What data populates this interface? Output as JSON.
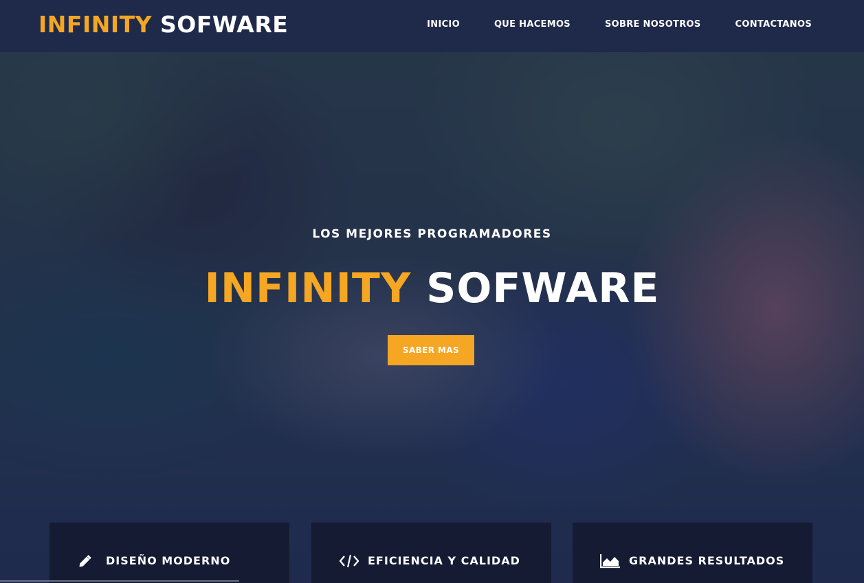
{
  "header": {
    "logo_accent": "INFINITY",
    "logo_rest": "SOFWARE",
    "nav": [
      {
        "label": "INICIO"
      },
      {
        "label": "QUE HACEMOS"
      },
      {
        "label": "SOBRE NOSOTROS"
      },
      {
        "label": "CONTACTANOS"
      }
    ]
  },
  "hero": {
    "subtitle": "LOS MEJORES PROGRAMADORES",
    "title_accent": "INFINITY",
    "title_rest": "SOFWARE",
    "cta_label": "SABER MAS"
  },
  "features": [
    {
      "icon": "pencil-icon",
      "title": "DISEÑO MODERNO"
    },
    {
      "icon": "code-icon",
      "title": "EFICIENCIA Y CALIDAD"
    },
    {
      "icon": "area-chart-icon",
      "title": "GRANDES RESULTADOS"
    }
  ],
  "colors": {
    "accent": "#f5a623",
    "header_bg": "#1f2a4a",
    "card_bg": "#141b33",
    "overlay": "#1c2852"
  }
}
